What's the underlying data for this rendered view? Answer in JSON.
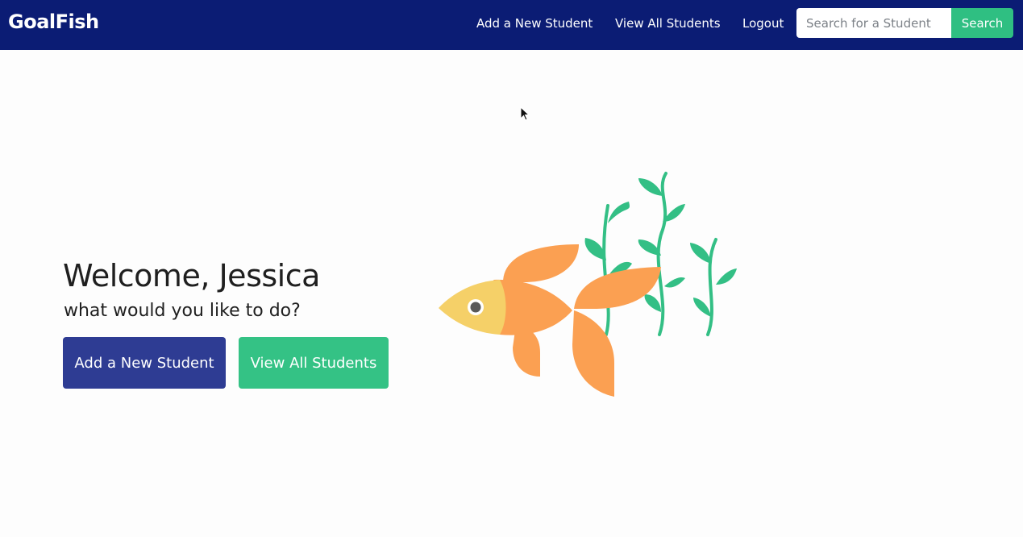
{
  "navbar": {
    "brand": "GoalFish",
    "links": [
      "Add a New Student",
      "View All Students",
      "Logout"
    ],
    "search": {
      "placeholder": "Search for a Student",
      "value": "",
      "button_label": "Search"
    }
  },
  "main": {
    "greeting": "Welcome, Jessica",
    "subtitle": "what would you like to do?",
    "buttons": {
      "add_student": "Add a New Student",
      "view_students": "View All Students"
    }
  },
  "illustration": "goldfish-with-seaweed",
  "colors": {
    "navbar_bg": "#0b1c74",
    "primary_button": "#2e3c93",
    "accent_green": "#34c285",
    "fish_orange": "#fba052",
    "fish_yellow": "#f5d068",
    "seaweed_green": "#33bf85"
  }
}
